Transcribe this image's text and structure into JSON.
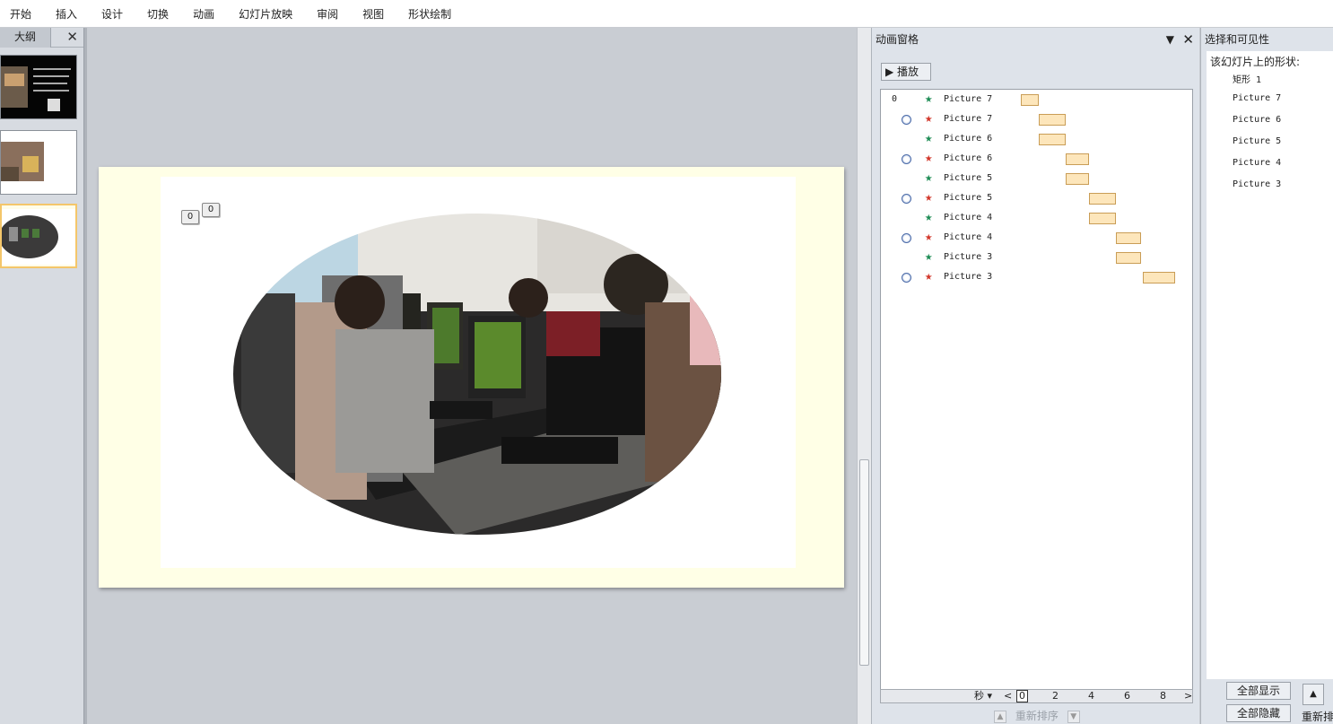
{
  "ribbon": {
    "tabs": [
      "开始",
      "插入",
      "设计",
      "切换",
      "动画",
      "幻灯片放映",
      "审阅",
      "视图",
      "形状绘制"
    ]
  },
  "outline": {
    "tab_label": "大纲",
    "close_glyph": "✕"
  },
  "slide": {
    "anim_tag_a": "0",
    "anim_tag_b": "0"
  },
  "animation_pane": {
    "title": "动画窗格",
    "dropdown_glyph": "▼",
    "close_glyph": "✕",
    "play_label": "▶  播放",
    "rows": [
      {
        "num": "0",
        "clock": false,
        "star": "green",
        "label": "Picture 7",
        "bar_start": 0,
        "bar_end": 1
      },
      {
        "num": "",
        "clock": true,
        "star": "red",
        "label": "Picture 7",
        "bar_start": 1,
        "bar_end": 2.5
      },
      {
        "num": "",
        "clock": false,
        "star": "green",
        "label": "Picture 6",
        "bar_start": 1,
        "bar_end": 2.5
      },
      {
        "num": "",
        "clock": true,
        "star": "red",
        "label": "Picture 6",
        "bar_start": 2.5,
        "bar_end": 3.8
      },
      {
        "num": "",
        "clock": false,
        "star": "green",
        "label": "Picture 5",
        "bar_start": 2.5,
        "bar_end": 3.8
      },
      {
        "num": "",
        "clock": true,
        "star": "red",
        "label": "Picture 5",
        "bar_start": 3.8,
        "bar_end": 5.3
      },
      {
        "num": "",
        "clock": false,
        "star": "green",
        "label": "Picture 4",
        "bar_start": 3.8,
        "bar_end": 5.3
      },
      {
        "num": "",
        "clock": true,
        "star": "red",
        "label": "Picture 4",
        "bar_start": 5.3,
        "bar_end": 6.7
      },
      {
        "num": "",
        "clock": false,
        "star": "green",
        "label": "Picture 3",
        "bar_start": 5.3,
        "bar_end": 6.7
      },
      {
        "num": "",
        "clock": true,
        "star": "red",
        "label": "Picture 3",
        "bar_start": 6.8,
        "bar_end": 8.6
      }
    ],
    "timeline": {
      "unit": "秒 ▾",
      "ticks": [
        "0",
        "2",
        "4",
        "6",
        "8"
      ],
      "prev_glyph": "<",
      "next_glyph": ">"
    },
    "reorder_label": "重新排序",
    "reorder_up": "▲",
    "reorder_down": "▼"
  },
  "selection_pane": {
    "title": "选择和可见性",
    "heading": "该幻灯片上的形状:",
    "items": [
      "矩形 1",
      "Picture 7",
      "Picture 6",
      "Picture 5",
      "Picture 4",
      "Picture 3"
    ],
    "show_all": "全部显示",
    "hide_all": "全部隐藏",
    "up_glyph": "▲",
    "reorder_label": "重新排"
  }
}
